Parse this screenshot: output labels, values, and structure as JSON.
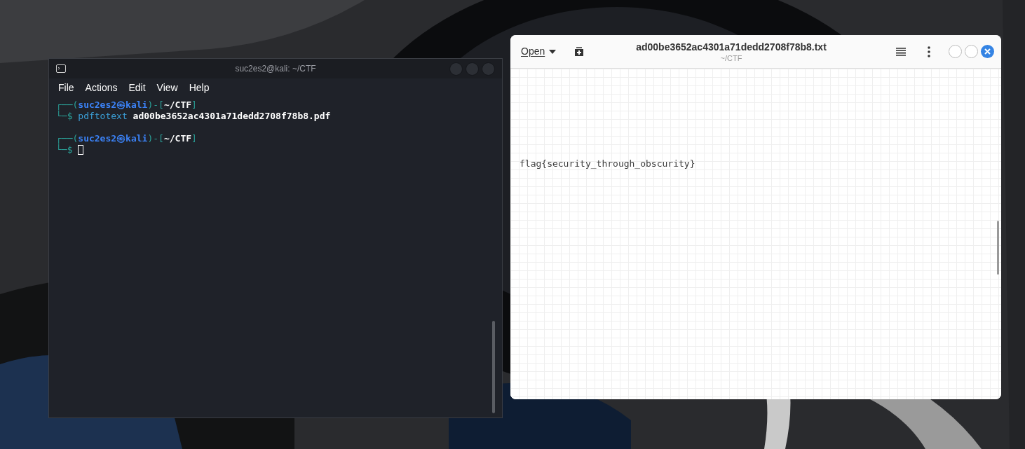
{
  "terminal": {
    "title": "suc2es2@kali: ~/CTF",
    "menu": [
      "File",
      "Actions",
      "Edit",
      "View",
      "Help"
    ],
    "prompts": [
      {
        "frame_top": "┌──(",
        "user": "suc2es2",
        "at": "㉿",
        "host": "kali",
        "mid": ")-[",
        "path": "~/CTF",
        "close": "]",
        "frame_bottom": "└─$",
        "command": "pdftotext",
        "argument": "ad00be3652ac4301a71dedd2708f78b8.pdf",
        "cursor": false
      },
      {
        "frame_top": "┌──(",
        "user": "suc2es2",
        "at": "㉿",
        "host": "kali",
        "mid": ")-[",
        "path": "~/CTF",
        "close": "]",
        "frame_bottom": "└─$",
        "cursor": true
      }
    ]
  },
  "editor": {
    "open_button": "Open",
    "title": "ad00be3652ac4301a71dedd2708f78b8.txt",
    "subtitle": "~/CTF",
    "text": "flag{security_through_obscurity}"
  }
}
